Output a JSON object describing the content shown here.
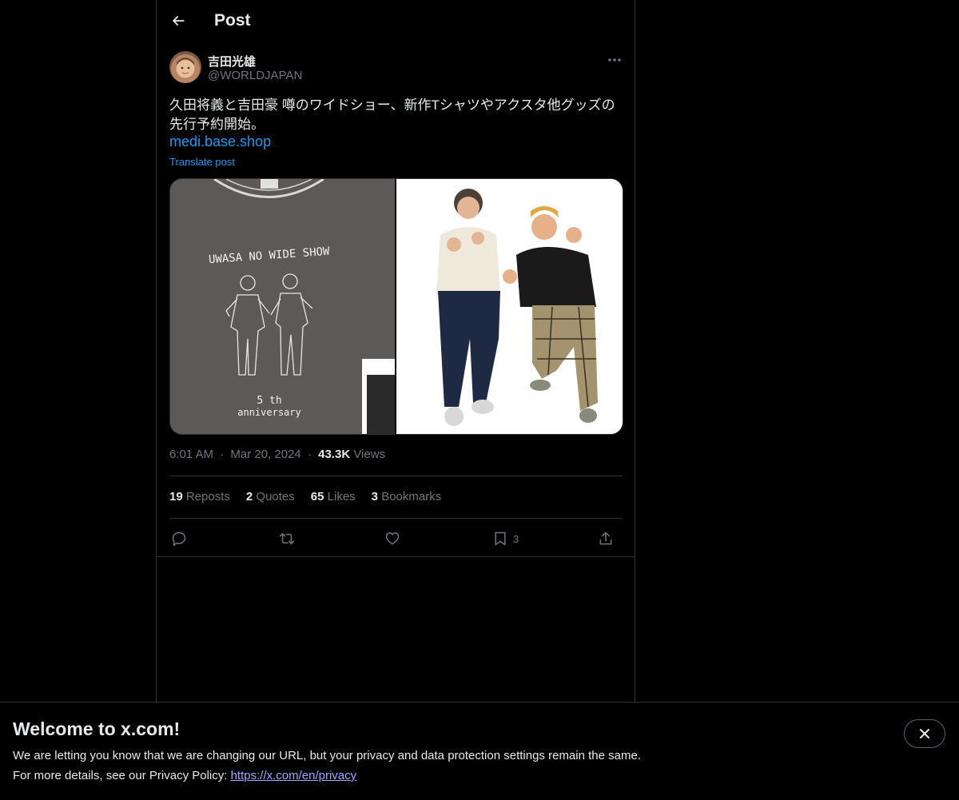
{
  "header": {
    "title": "Post"
  },
  "author": {
    "name": "吉田光雄",
    "handle": "@WORLDJAPAN"
  },
  "post": {
    "text": "久田将義と吉田豪 噂のワイドショー、新作Tシャツやアクスタ他グッズの先行予約開始。",
    "link": "medi.base.shop",
    "translate_label": "Translate post",
    "media": {
      "left_image_text": [
        "UWASA NO WIDE SHOW",
        "5 th",
        "anniversary"
      ]
    }
  },
  "meta": {
    "time": "6:01 AM",
    "separator": "·",
    "date": "Mar 20, 2024",
    "views_count": "43.3K",
    "views_label": "Views"
  },
  "stats": {
    "reposts_count": "19",
    "reposts_label": "Reposts",
    "quotes_count": "2",
    "quotes_label": "Quotes",
    "likes_count": "65",
    "likes_label": "Likes",
    "bookmarks_count": "3",
    "bookmarks_label": "Bookmarks"
  },
  "actions": {
    "bookmark_count": "3",
    "icons": [
      "reply-icon",
      "repost-icon",
      "like-icon",
      "bookmark-icon",
      "share-icon"
    ]
  },
  "banner": {
    "title": "Welcome to x.com!",
    "line1": "We are letting you know that we are changing our URL, but your privacy and data protection settings remain the same.",
    "line2_prefix": "For more details, see our Privacy Policy: ",
    "link": "https://x.com/en/privacy"
  },
  "colors": {
    "background": "#000000",
    "text": "#e7e9ea",
    "muted": "#71767b",
    "accent": "#1d9bf0",
    "border": "#2f3336",
    "banner_link": "#a9a5ff"
  }
}
